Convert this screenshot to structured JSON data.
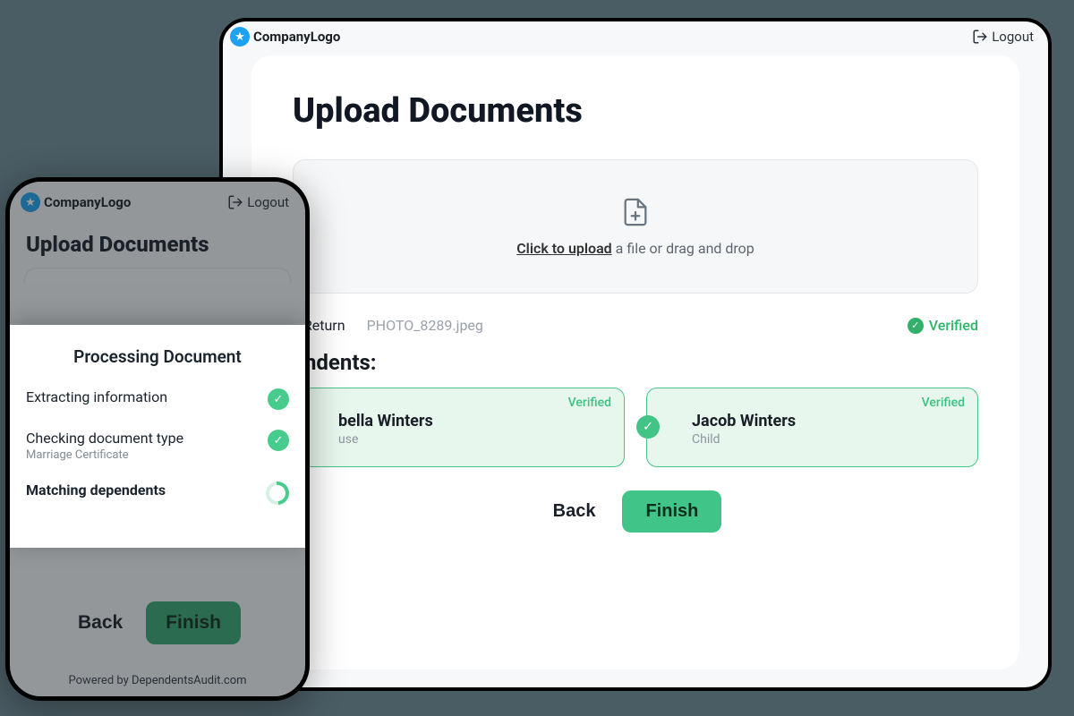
{
  "header": {
    "logo_text": "CompanyLogo",
    "logout": "Logout"
  },
  "main": {
    "title": "Upload Documents",
    "drop_click": "Click to upload",
    "drop_rest": " a file or drag and drop",
    "file_kind": "x Return",
    "file_name": "PHOTO_8289.jpeg",
    "verified": "Verified",
    "dependents_label": "endents:",
    "cards": [
      {
        "name": "bella Winters",
        "role": "use",
        "badge": "Verified"
      },
      {
        "name": "Jacob Winters",
        "role": "Child",
        "badge": "Verified"
      }
    ],
    "back": "Back",
    "finish": "Finish"
  },
  "phone": {
    "title": "Upload Documents",
    "sheet_title": "Processing Document",
    "steps": [
      {
        "label": "Extracting information",
        "sub": "",
        "state": "done"
      },
      {
        "label": "Checking document type",
        "sub": "Marriage Certificate",
        "state": "done"
      },
      {
        "label": "Matching dependents",
        "sub": "",
        "state": "loading"
      }
    ],
    "back": "Back",
    "finish": "Finish",
    "powered_prefix": "Powered by ",
    "powered_link": "DependentsAudit.com"
  }
}
